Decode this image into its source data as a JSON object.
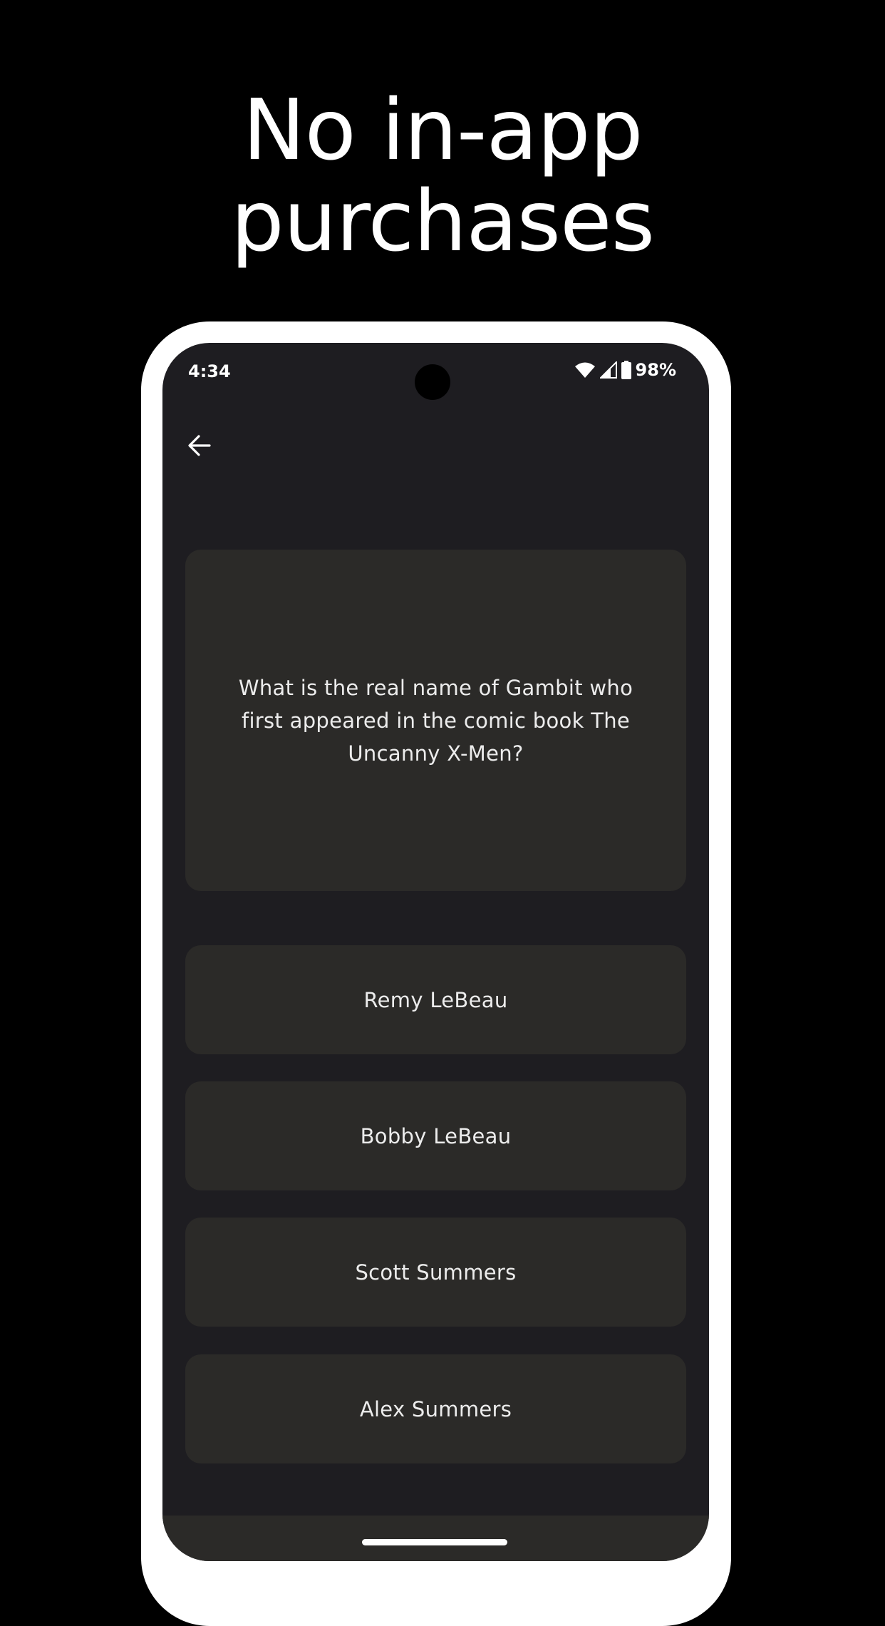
{
  "headline": {
    "line1": "No in-app",
    "line2": "purchases"
  },
  "status_bar": {
    "time": "4:34",
    "battery": "98%",
    "icons": [
      "wifi-icon",
      "signal-icon",
      "battery-icon"
    ]
  },
  "toolbar": {
    "back_icon": "arrow-left-icon"
  },
  "question": {
    "text": "What is the real name of Gambit who first appeared in the comic book The Uncanny X-Men?"
  },
  "answers": [
    {
      "label": "Remy LeBeau"
    },
    {
      "label": "Bobby LeBeau"
    },
    {
      "label": "Scott Summers"
    },
    {
      "label": "Alex Summers"
    }
  ],
  "colors": {
    "background": "#000000",
    "phone_frame": "#ffffff",
    "screen": "#1e1d21",
    "card": "#2b2a28",
    "text": "#ececec"
  }
}
